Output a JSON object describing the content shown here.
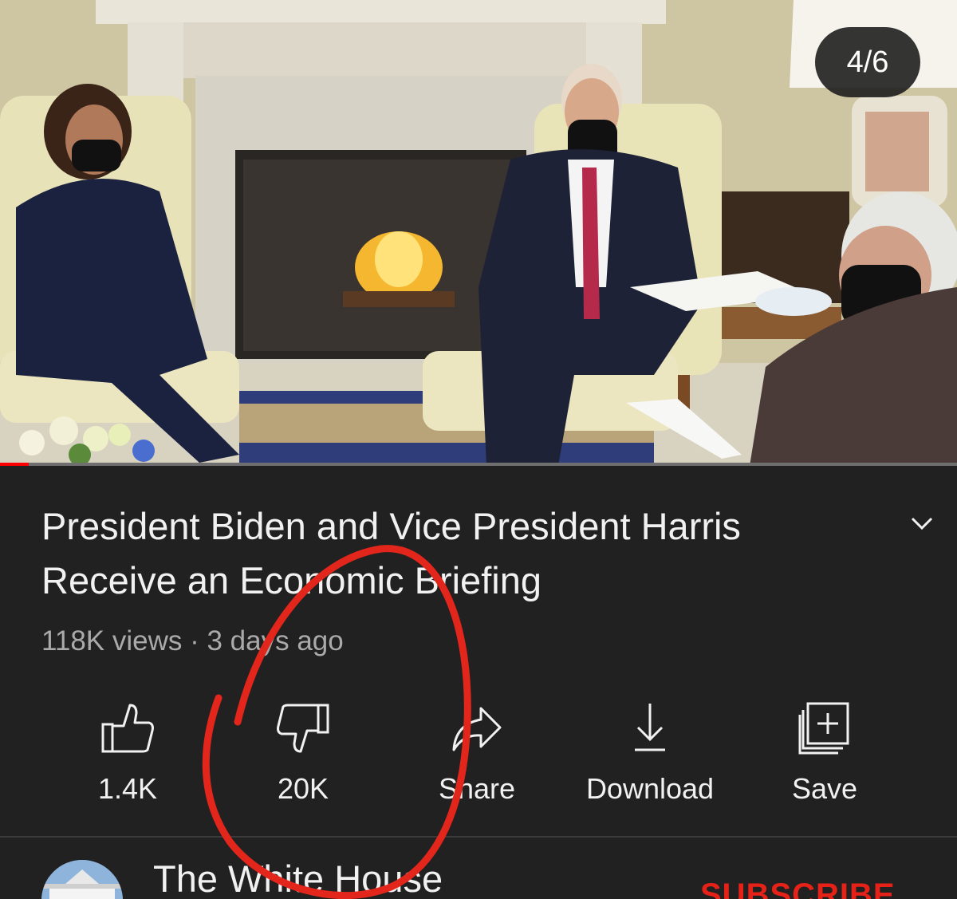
{
  "video": {
    "counter": "4/6",
    "progress_fraction": 0.03
  },
  "details": {
    "title_line1": "President Biden and Vice President Harris",
    "title_line2": "Receive an Economic Briefing",
    "meta": "118K views · 3 days ago"
  },
  "actions": {
    "like_label": "1.4K",
    "dislike_label": "20K",
    "share_label": "Share",
    "download_label": "Download",
    "save_label": "Save"
  },
  "channel": {
    "name": "The White House",
    "subscribe_label": "SUBSCRIBE"
  },
  "icons": {
    "expand": "chevron-down-icon",
    "like": "thumbs-up-icon",
    "dislike": "thumbs-down-icon",
    "share": "share-arrow-icon",
    "download": "download-icon",
    "save": "add-to-playlist-icon"
  },
  "colors": {
    "background": "#212121",
    "text": "#f1f1f1",
    "secondary_text": "#aaaaaa",
    "accent": "#ff0000",
    "subscribe": "#e62117",
    "annotation": "#e3261c"
  }
}
